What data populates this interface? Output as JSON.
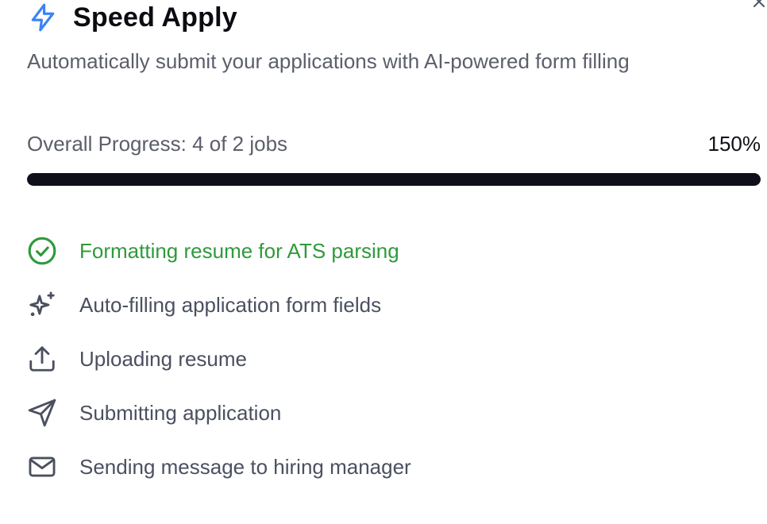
{
  "dialog": {
    "title": "Speed Apply",
    "subtitle": "Automatically submit your applications with AI-powered form filling",
    "close_icon": "close-icon",
    "title_icon": "lightning-bolt-icon"
  },
  "progress": {
    "label": "Overall Progress: 4 of 2 jobs",
    "percent_text": "150%",
    "fill_fraction": 1.0
  },
  "steps": [
    {
      "label": "Formatting resume for ATS parsing",
      "icon": "check-circle-icon",
      "status": "done"
    },
    {
      "label": "Auto-filling application form fields",
      "icon": "sparkles-icon",
      "status": "pending"
    },
    {
      "label": "Uploading resume",
      "icon": "upload-icon",
      "status": "pending"
    },
    {
      "label": "Submitting application",
      "icon": "send-icon",
      "status": "pending"
    },
    {
      "label": "Sending message to hiring manager",
      "icon": "mail-icon",
      "status": "pending"
    }
  ],
  "colors": {
    "accent_blue": "#3b82f6",
    "success_green": "#2f9a3b",
    "progress_fill": "#0f0f1c",
    "muted_text": "#5b5f6b"
  }
}
